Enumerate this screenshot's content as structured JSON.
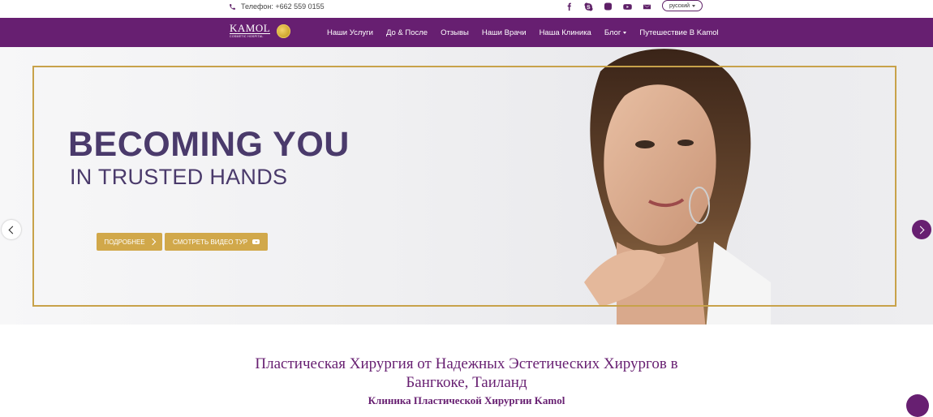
{
  "topbar": {
    "phone_text": "Телефон: +662 559 0155",
    "socials": [
      "facebook-icon",
      "skype-icon",
      "instagram-icon",
      "youtube-icon",
      "mail-icon"
    ],
    "language": "русский"
  },
  "nav": {
    "logo_word": "KAMOL",
    "logo_sub": "COSMETIC HOSPITAL",
    "items": [
      {
        "label": "Наши Услуги"
      },
      {
        "label": "До & После"
      },
      {
        "label": "Отзывы"
      },
      {
        "label": "Наши Врачи"
      },
      {
        "label": "Наша Клиника"
      },
      {
        "label": "Блог"
      },
      {
        "label": "Путешествие В Kamol"
      }
    ]
  },
  "hero": {
    "headline_1": "BECOMING YOU",
    "headline_2": "IN TRUSTED HANDS",
    "btn_more": "ПОДРОБНЕЕ",
    "btn_video": "СМОТРЕТЬ ВИДЕО ТУР"
  },
  "content": {
    "title_line1": "Пластическая Хирургия от Надежных Эстетических Хирургов в",
    "title_line2": "Бангкоке, Таиланд",
    "subtitle": "Клиника Пластической Хирургии Kamol"
  },
  "colors": {
    "brand_purple": "#671f71",
    "gold": "#d1a84a",
    "headline": "#4a3a6b"
  }
}
